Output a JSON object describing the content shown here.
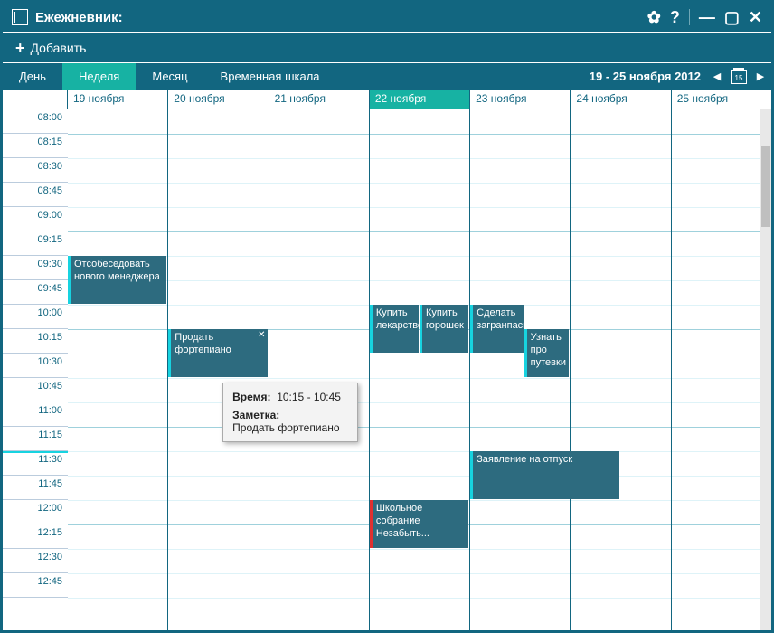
{
  "window": {
    "title": "Ежежневник:"
  },
  "toolbar": {
    "add_label": "Добавить"
  },
  "nav": {
    "tabs": [
      {
        "label": "День",
        "active": false
      },
      {
        "label": "Неделя",
        "active": true
      },
      {
        "label": "Месяц",
        "active": false
      },
      {
        "label": "Временная шкала",
        "active": false
      }
    ],
    "date_range": "19  - 25 ноября 2012",
    "today_num": "15"
  },
  "days": [
    {
      "label": "19 ноября",
      "today": false
    },
    {
      "label": "20 ноября",
      "today": false
    },
    {
      "label": "21 ноября",
      "today": false
    },
    {
      "label": "22 ноября",
      "today": true
    },
    {
      "label": "23 ноября",
      "today": false
    },
    {
      "label": "24 ноября",
      "today": false
    },
    {
      "label": "25 ноября",
      "today": false
    }
  ],
  "timeslots": [
    "08:00",
    "08:15",
    "08:30",
    "08:45",
    "09:00",
    "09:15",
    "09:30",
    "09:45",
    "10:00",
    "10:15",
    "10:30",
    "10:45",
    "11:00",
    "11:15",
    "11:30",
    "11:45",
    "12:00",
    "12:15",
    "12:30",
    "12:45"
  ],
  "events": [
    {
      "day": 0,
      "title": "Отсобеседовать нового менеджера",
      "start": "09:30",
      "end": "10:00",
      "left_pct": 0,
      "width_pct": 100,
      "accent": "cyan"
    },
    {
      "day": 1,
      "title": "Продать фортепиано",
      "start": "10:15",
      "end": "10:45",
      "left_pct": 0,
      "width_pct": 100,
      "accent": "cyan",
      "showClose": true
    },
    {
      "day": 3,
      "title": "Купить лекарство",
      "start": "10:00",
      "end": "10:30",
      "left_pct": 0,
      "width_pct": 50,
      "accent": "cyan"
    },
    {
      "day": 3,
      "title": "Купить горошек",
      "start": "10:00",
      "end": "10:30",
      "left_pct": 50,
      "width_pct": 50,
      "accent": "cyan"
    },
    {
      "day": 3,
      "title": "Школьное собрание Незабыть...",
      "start": "12:00",
      "end": "12:30",
      "left_pct": 0,
      "width_pct": 100,
      "accent": "red"
    },
    {
      "day": 4,
      "title": "Сделать загранпаспорт",
      "start": "10:00",
      "end": "10:30",
      "left_pct": 0,
      "width_pct": 54,
      "accent": "cyan"
    },
    {
      "day": 4,
      "title": "Узнать про путевки",
      "start": "10:15",
      "end": "10:45",
      "left_pct": 54,
      "width_pct": 46,
      "accent": "cyan"
    },
    {
      "day": 4,
      "title": "Заявление на отпуск",
      "start": "11:30",
      "end": "12:00",
      "left_pct": 0,
      "width_pct": 150,
      "accent": "cyan"
    }
  ],
  "tooltip": {
    "time_label": "Время:",
    "time_value": "10:15 - 10:45",
    "note_label": "Заметка:",
    "note_value": "Продать фортепиано"
  },
  "nowline_time": "11:30"
}
